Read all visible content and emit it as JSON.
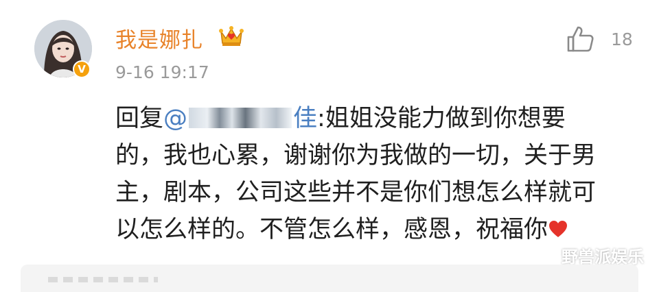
{
  "comment": {
    "username": "我是娜扎",
    "timestamp": "9-16 19:17",
    "like_count": "18",
    "verified_badge": "V",
    "body": {
      "reply_prefix": "回复",
      "mention_start": "@",
      "mention_end": "佳",
      "line1_rest": ":姐姐没能力做到你想要",
      "line2": "的，我也心累，谢谢你为我做的一切，关于男",
      "line3": "主，剧本，公司这些并不是你们想怎么样就可",
      "line4": "以怎么样的。不管怎么样，感恩，祝福你"
    }
  },
  "watermark": {
    "text": "野兽派娱乐"
  },
  "colors": {
    "username": "#e8832a",
    "mention": "#4a7fc1",
    "meta": "#9a9a9a",
    "badge": "#f5a10e",
    "heart": "#e5332a"
  },
  "icons": [
    "crown-icon",
    "like-icon",
    "heart-icon",
    "wechat-icon",
    "verified-badge"
  ]
}
